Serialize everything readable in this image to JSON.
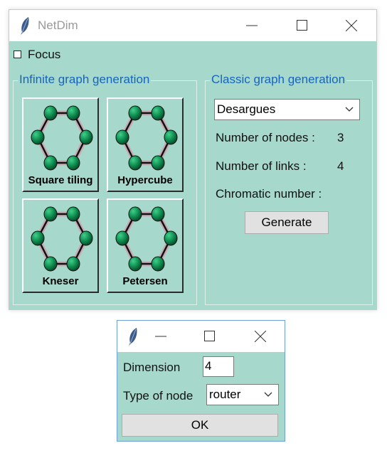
{
  "main_window": {
    "title": "NetDim",
    "focus_label": "Focus",
    "focus_checked": false,
    "infinite_group": {
      "title": "Infinite graph generation",
      "buttons": [
        {
          "label": "Square tiling",
          "icon": "hexagon-graph-icon"
        },
        {
          "label": "Hypercube",
          "icon": "hexagon-graph-icon"
        },
        {
          "label": "Kneser",
          "icon": "hexagon-graph-icon"
        },
        {
          "label": "Petersen",
          "icon": "hexagon-graph-icon"
        }
      ]
    },
    "classic_group": {
      "title": "Classic graph generation",
      "selected_graph": "Desargues",
      "nodes_label": "Number of nodes :",
      "nodes_value": "3",
      "links_label": "Number of links :",
      "links_value": "4",
      "chromatic_label": "Chromatic number :",
      "chromatic_value": "",
      "generate_label": "Generate"
    }
  },
  "dialog": {
    "dimension_label": "Dimension",
    "dimension_value": "4",
    "node_type_label": "Type of node",
    "node_type_value": "router",
    "ok_label": "OK"
  },
  "colors": {
    "window_bg": "#a6d9cc",
    "group_title": "#1565c0",
    "node_fill": "#0e8a4e"
  }
}
